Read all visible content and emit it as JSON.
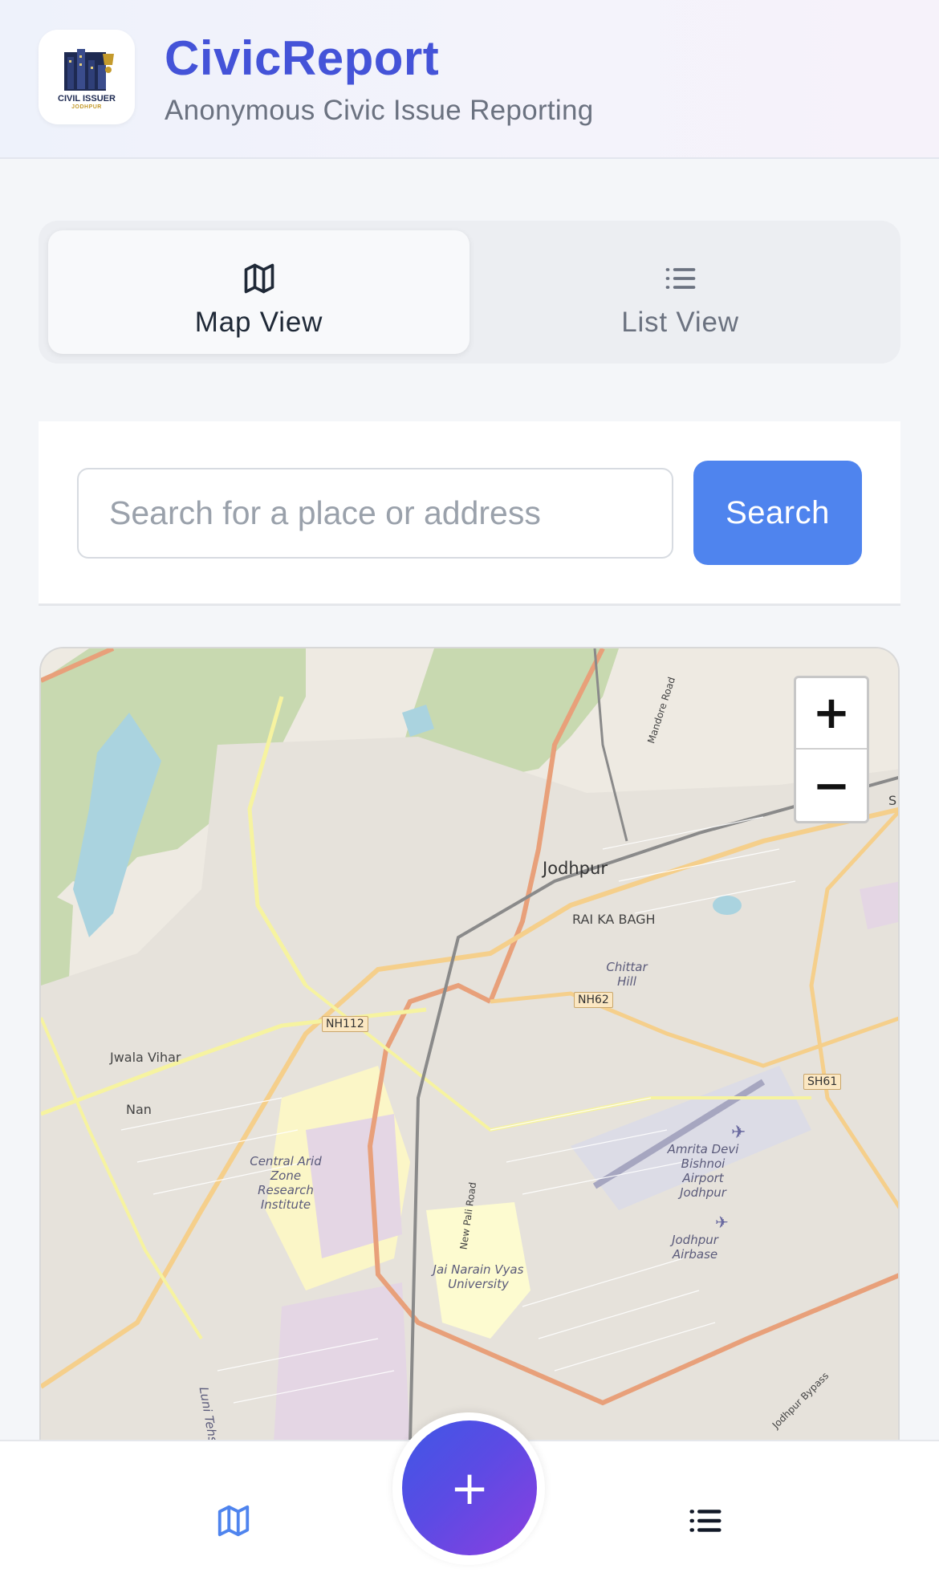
{
  "app": {
    "title": "CivicReport",
    "subtitle": "Anonymous Civic Issue Reporting",
    "logo": {
      "line1": "CIVIL ISSUER",
      "line2": "JODHPUR"
    }
  },
  "tabs": [
    {
      "label": "Map View",
      "icon": "map-icon",
      "active": true
    },
    {
      "label": "List View",
      "icon": "list-icon",
      "active": false
    }
  ],
  "search": {
    "placeholder": "Search for a place or address",
    "value": "",
    "button_label": "Search"
  },
  "map": {
    "zoom_in": "+",
    "zoom_out": "−",
    "labels": {
      "jodhpur": "Jodhpur",
      "rai_ka_bagh": "RAI KA BAGH",
      "chittar_hill": "Chittar Hill",
      "jwala_vihar": "Jwala Vihar",
      "nan": "Nan",
      "cazri": "Central Arid Zone Research Institute",
      "jnvu": "Jai Narain Vyas University",
      "airport": "Amrita Devi Bishnoi Airport Jodhpur",
      "airbase": "Jodhpur Airbase",
      "new_pali_road": "New Pali Road",
      "mandore_road": "Mandore Road",
      "luni_tehsil": "Luni Tehsil",
      "jodhpur_bypass": "Jodhpur Bypass",
      "edge_s": "S"
    },
    "shields": {
      "nh112": "NH112",
      "nh62": "NH62",
      "sh61": "SH61"
    }
  },
  "bottom_nav": {
    "fab_label": "+",
    "items": [
      {
        "icon": "map-icon"
      },
      {
        "icon": "list-icon"
      }
    ]
  },
  "colors": {
    "brand": "#4453d8",
    "search_button": "#4f84ee",
    "fab_gradient_start": "#3f57e6",
    "fab_gradient_end": "#8b3fe0",
    "nav_map_active": "#4f84ee"
  }
}
